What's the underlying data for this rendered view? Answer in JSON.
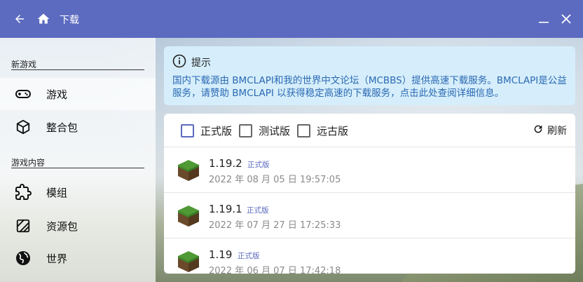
{
  "app": {
    "title": "下载"
  },
  "titlebar": {
    "back_icon": "arrow-left-icon",
    "home_icon": "home-icon",
    "minimize_icon": "minimize-icon",
    "close_icon": "close-icon"
  },
  "sidebar": {
    "sections": [
      {
        "title": "新游戏",
        "items": [
          {
            "label": "游戏",
            "icon": "gamepad-icon"
          },
          {
            "label": "整合包",
            "icon": "package-icon"
          }
        ]
      },
      {
        "title": "游戏内容",
        "items": [
          {
            "label": "模组",
            "icon": "puzzle-icon"
          },
          {
            "label": "资源包",
            "icon": "texture-icon"
          },
          {
            "label": "世界",
            "icon": "globe-icon"
          }
        ]
      }
    ]
  },
  "hint": {
    "title": "提示",
    "text": "国内下载源由 BMCLAPI和我的世界中文论坛（MCBBS）提供高速下载服务。BMCLAPI是公益服务，请赞助 BMCLAPI 以获得稳定高速的下载服务，点击此处查阅详细信息。"
  },
  "filters": [
    {
      "label": "正式版",
      "checked": true
    },
    {
      "label": "测试版",
      "checked": false
    },
    {
      "label": "远古版",
      "checked": false
    }
  ],
  "refresh_label": "刷新",
  "versions": [
    {
      "version": "1.19.2",
      "type": "正式版",
      "date": "2022 年 08 月 05 日 19:57:05"
    },
    {
      "version": "1.19.1",
      "type": "正式版",
      "date": "2022 年 07 月 27 日 17:25:33"
    },
    {
      "version": "1.19",
      "type": "正式版",
      "date": "2022 年 06 月 07 日 17:42:18"
    }
  ],
  "colors": {
    "accent": "#5c6bc0",
    "hint_bg": "#d6eefb",
    "hint_text": "#2a69b3"
  }
}
